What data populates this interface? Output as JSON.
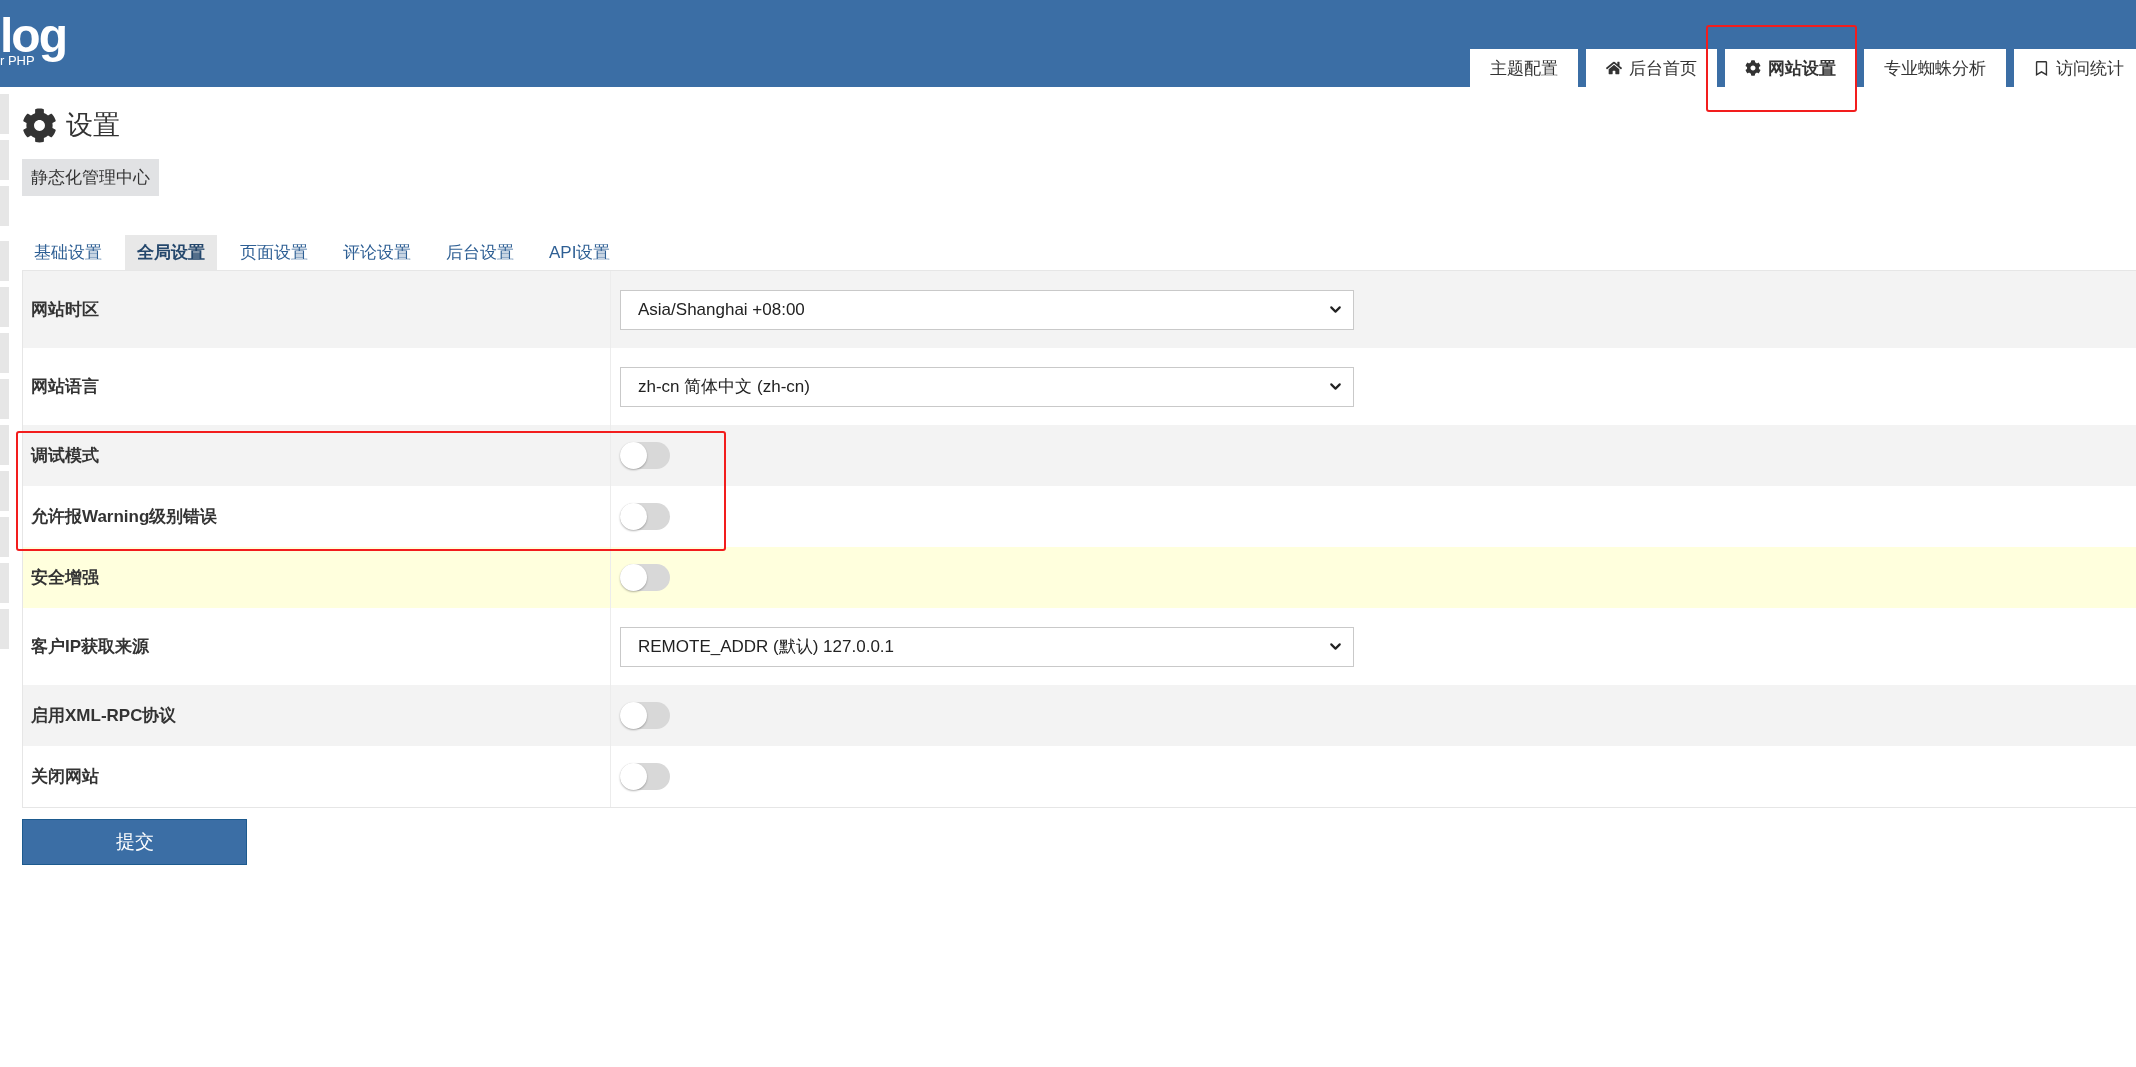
{
  "header": {
    "logo": {
      "title": "log",
      "subtitle": "r PHP"
    },
    "nav_tabs": [
      {
        "label": "主题配置",
        "kind": "text",
        "selected": false,
        "annotated": false
      },
      {
        "label": "后台首页",
        "kind": "home",
        "selected": false,
        "annotated": false
      },
      {
        "label": "网站设置",
        "kind": "settings",
        "selected": true,
        "annotated": true
      },
      {
        "label": "专业蜘蛛分析",
        "kind": "text",
        "selected": false,
        "annotated": false
      },
      {
        "label": "访问统计",
        "kind": "bookmark",
        "selected": false,
        "annotated": false
      }
    ]
  },
  "page": {
    "title": "设置",
    "action_button": "静态化管理中心"
  },
  "settings_tabs": [
    {
      "label": "基础设置",
      "selected": false
    },
    {
      "label": "全局设置",
      "selected": true
    },
    {
      "label": "页面设置",
      "selected": false
    },
    {
      "label": "评论设置",
      "selected": false
    },
    {
      "label": "后台设置",
      "selected": false
    },
    {
      "label": "API设置",
      "selected": false
    }
  ],
  "rows": [
    {
      "label": "网站时区",
      "kind": "select",
      "value": "Asia/Shanghai +08:00",
      "hovered": false,
      "annotated": false
    },
    {
      "label": "网站语言",
      "kind": "select",
      "value": "zh-cn 简体中文 (zh-cn)",
      "hovered": false,
      "annotated": false
    },
    {
      "label": "调试模式",
      "kind": "toggle",
      "on": false,
      "hovered": false,
      "annotated": true
    },
    {
      "label": "允许报Warning级别错误",
      "kind": "toggle",
      "on": false,
      "hovered": false,
      "annotated": true
    },
    {
      "label": "安全增强",
      "kind": "toggle",
      "on": false,
      "hovered": true,
      "annotated": false
    },
    {
      "label": "客户IP获取来源",
      "kind": "select",
      "value": "REMOTE_ADDR (默认) 127.0.0.1",
      "hovered": false,
      "annotated": false
    },
    {
      "label": "启用XML-RPC协议",
      "kind": "toggle",
      "on": false,
      "hovered": false,
      "annotated": false
    },
    {
      "label": "关闭网站",
      "kind": "toggle",
      "on": false,
      "hovered": false,
      "annotated": false
    }
  ],
  "submit_button": "提交"
}
